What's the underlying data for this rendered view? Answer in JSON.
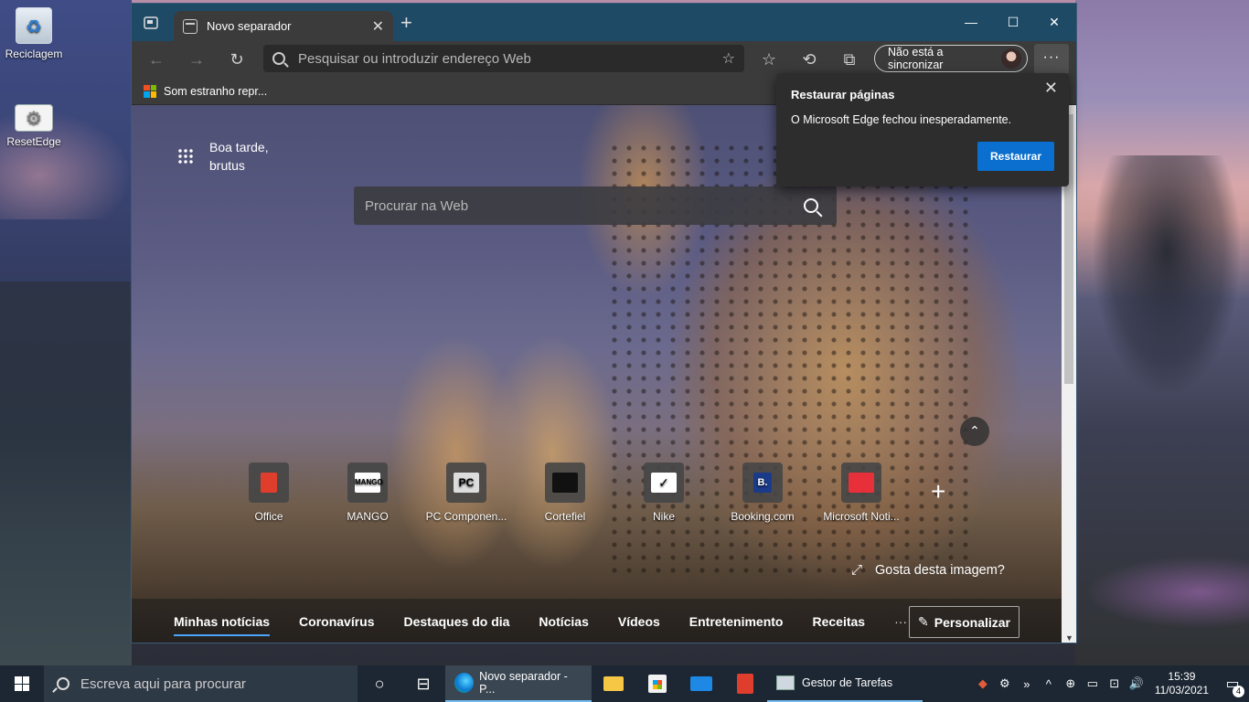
{
  "desktop": {
    "icons": [
      {
        "label": "Reciclagem"
      },
      {
        "label": "ResetEdge"
      }
    ]
  },
  "browser": {
    "tab": {
      "title": "Novo separador",
      "close": "✕"
    },
    "new_tab": "+",
    "window": {
      "minimize": "—",
      "maximize": "☐",
      "close": "✕"
    },
    "toolbar": {
      "back": "←",
      "forward": "→",
      "refresh": "↻",
      "address_placeholder": "Pesquisar ou introduzir endereço Web",
      "favorites": "☆",
      "history": "⟲",
      "collections": "⧉",
      "sync_label": "Não está a sincronizar",
      "more": "···"
    },
    "favorites_bar": [
      {
        "label": "Som estranho repr..."
      }
    ]
  },
  "page": {
    "greeting": "Boa tarde,",
    "user": "brutus",
    "search_placeholder": "Procurar na Web",
    "collapse": "⌃",
    "quick_links": [
      {
        "label": "Office",
        "mark": "",
        "color": "#e03e2d"
      },
      {
        "label": "MANGO",
        "mark": "MANGO",
        "color": "#ffffff"
      },
      {
        "label": "PC Componen...",
        "mark": "PC",
        "color": "#dddddd"
      },
      {
        "label": "Cortefiel",
        "mark": "",
        "color": "#111111"
      },
      {
        "label": "Nike",
        "mark": "✓",
        "color": "#ffffff"
      },
      {
        "label": "Booking.com",
        "mark": "B.",
        "color": "#1a3a8a"
      },
      {
        "label": "Microsoft Noti...",
        "mark": "",
        "color": "#e8303a"
      }
    ],
    "add_link": "+",
    "like_image": "Gosta desta imagem?",
    "expand": "⤢",
    "news_tabs": [
      "Minhas notícias",
      "Coronavírus",
      "Destaques do dia",
      "Notícias",
      "Vídeos",
      "Entretenimento",
      "Receitas"
    ],
    "news_more": "···",
    "personalize": "Personalizar",
    "scroll_down": "▼"
  },
  "popup": {
    "title": "Restaurar páginas",
    "message": "O Microsoft Edge fechou inesperadamente.",
    "button": "Restaurar",
    "close": "✕"
  },
  "taskbar": {
    "search_placeholder": "Escreva aqui para procurar",
    "cortana": "○",
    "task_view": "⊟",
    "apps": [
      {
        "label": "Novo separador - P..."
      },
      {
        "label": "Gestor de Tarefas"
      }
    ],
    "tray": {
      "time": "15:39",
      "date": "11/03/2021",
      "notifications": "4",
      "chevron": "^",
      "icons": [
        "⊕",
        "▭",
        "⊡",
        "🔊"
      ]
    }
  }
}
